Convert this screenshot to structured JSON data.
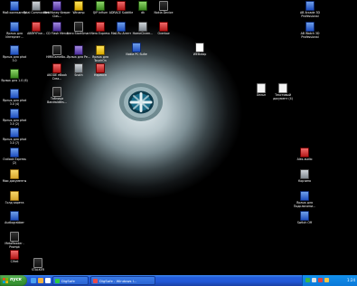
{
  "desktop_icons": [
    {
      "label": "Мой компьютер",
      "icon": "computer-icon",
      "color": "i-blue"
    },
    {
      "label": "Total Commander",
      "icon": "app-icon",
      "color": "i-gray"
    },
    {
      "label": "WebMoney Keeper Clas...",
      "icon": "app-icon",
      "color": "i-purple"
    },
    {
      "label": "Winamp",
      "icon": "app-icon",
      "color": "i-yellow"
    },
    {
      "label": "QIP Infium",
      "icon": "app-icon",
      "color": "i-green"
    },
    {
      "label": "ADRACE Subtitle",
      "icon": "app-icon",
      "color": "i-red"
    },
    {
      "label": "dk",
      "icon": "app-icon",
      "color": "i-green"
    },
    {
      "label": "Nokia Device",
      "icon": "app-icon",
      "color": "i-dark"
    },
    {
      "label": "AB Arcade 3D Professional",
      "icon": "app-icon",
      "color": "i-blue"
    },
    {
      "label": "Ярлык для Интернет...",
      "icon": "shortcut-icon",
      "color": "i-blue"
    },
    {
      "label": "ABBYYFine...",
      "icon": "app-icon",
      "color": "i-red"
    },
    {
      "label": "CD Flash Menu",
      "icon": "app-icon",
      "color": "i-purple"
    },
    {
      "label": "Nero StartSmart",
      "icon": "app-icon",
      "color": "i-dark"
    },
    {
      "label": "Nero Express",
      "icon": "app-icon",
      "color": "i-red"
    },
    {
      "label": "Mail.Ru Агент",
      "icon": "app-icon",
      "color": "i-blue"
    },
    {
      "label": "HomeCinem...",
      "icon": "app-icon",
      "color": "i-gray"
    },
    {
      "label": "Overlow",
      "icon": "app-icon",
      "color": "i-red"
    },
    {
      "label": "AB Watch 3D Professional",
      "icon": "app-icon",
      "color": "i-blue"
    },
    {
      "label": "Ярлык для phot 3.0",
      "icon": "shortcut-icon",
      "color": "i-blue"
    },
    {
      "label": "HMKGameBo...",
      "icon": "app-icon",
      "color": "i-dark"
    },
    {
      "label": "Ярлык для Ре...",
      "icon": "shortcut-icon",
      "color": "i-purple"
    },
    {
      "label": "Ярлык для TouchOn",
      "icon": "shortcut-icon",
      "color": "i-yellow"
    },
    {
      "label": "Nokia PC Suite",
      "icon": "app-icon",
      "color": "i-blue"
    },
    {
      "label": "WEBxtap",
      "icon": "app-icon",
      "color": "i-white"
    },
    {
      "label": "Ярлык для 1.0 (6)",
      "icon": "shortcut-icon",
      "color": "i-green"
    },
    {
      "label": "AKODE eBook Crea...",
      "icon": "app-icon",
      "color": "i-red"
    },
    {
      "label": "Snoth",
      "icon": "app-icon",
      "color": "i-gray"
    },
    {
      "label": "Нэрексп",
      "icon": "app-icon",
      "color": "i-red"
    },
    {
      "label": "Ярлык для phot 3.0 (4)",
      "icon": "shortcut-icon",
      "color": "i-blue"
    },
    {
      "label": "Таблица Bandwidths...",
      "icon": "app-icon",
      "color": "i-dark"
    },
    {
      "label": "Хельп",
      "icon": "document-icon",
      "color": "i-doc"
    },
    {
      "label": "Текстовый документ (4)",
      "icon": "document-icon",
      "color": "i-doc"
    },
    {
      "label": "Ярлык для phot 3.0 (2)",
      "icon": "shortcut-icon",
      "color": "i-blue"
    },
    {
      "label": "Ярлык для phot 3.0 (7)",
      "icon": "shortcut-icon",
      "color": "i-blue"
    },
    {
      "label": "Outlook Express (2)",
      "icon": "mail-icon",
      "color": "i-blue"
    },
    {
      "label": "Мои документы",
      "icon": "folder-icon",
      "color": "i-folder"
    },
    {
      "label": "Alex-audio",
      "icon": "app-icon",
      "color": "i-red"
    },
    {
      "label": "Корзина",
      "icon": "recycle-bin-icon",
      "color": "i-gray"
    },
    {
      "label": "Голд карета",
      "icon": "folder-icon",
      "color": "i-folder"
    },
    {
      "label": "Audiograbber",
      "icon": "app-icon",
      "color": "i-blue"
    },
    {
      "label": "Ярлык для Подключени...",
      "icon": "shortcut-icon",
      "color": "i-blue"
    },
    {
      "label": "MetaReader - Prompt",
      "icon": "app-icon",
      "color": "i-dark"
    },
    {
      "label": "Switch Off",
      "icon": "app-icon",
      "color": "i-blue"
    },
    {
      "label": "Cifret",
      "icon": "app-icon",
      "color": "i-red"
    },
    {
      "label": "STALKER",
      "icon": "game-icon",
      "color": "i-dark"
    }
  ],
  "taskbar": {
    "start_label": "пуск",
    "tasks": [
      {
        "label": "DigSafe",
        "icon": "app-icon"
      },
      {
        "label": "DigSafe - Windows I...",
        "icon": "app-icon"
      }
    ],
    "clock": "1:24"
  },
  "colors": {
    "taskbar": "#245edc",
    "start": "#3c9b38",
    "tray": "#0b78d8"
  }
}
